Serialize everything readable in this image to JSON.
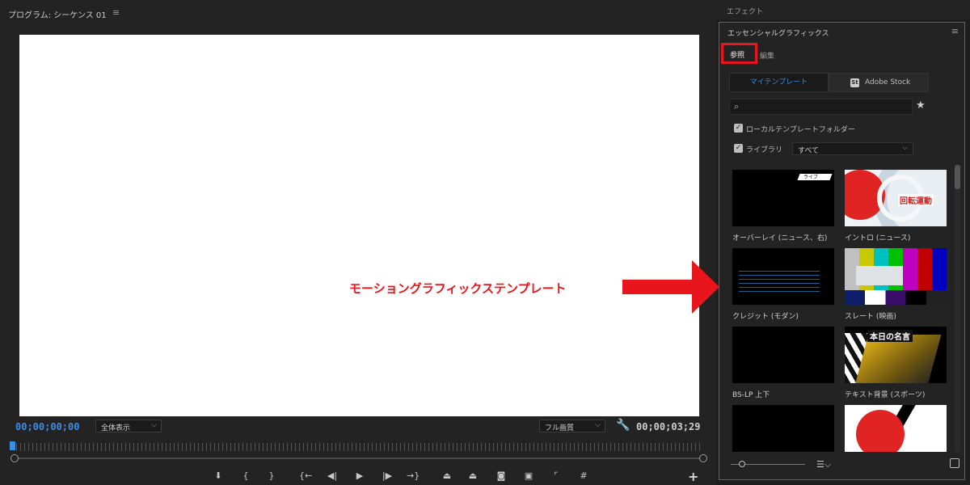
{
  "program": {
    "title": "プログラム: シーケンス 01",
    "menu_icon": "hamburger-icon",
    "current_timecode": "00;00;00;00",
    "duration_timecode": "00;00;03;29",
    "zoom_select": "全体表示",
    "quality_select": "フル画質",
    "controls": [
      {
        "name": "add-marker-button",
        "glyph": "⬇"
      },
      {
        "name": "mark-in-button",
        "glyph": "{"
      },
      {
        "name": "mark-out-button",
        "glyph": "}"
      },
      {
        "name": "go-to-in-button",
        "glyph": "{←"
      },
      {
        "name": "step-back-button",
        "glyph": "◀|"
      },
      {
        "name": "play-button",
        "glyph": "▶"
      },
      {
        "name": "step-forward-button",
        "glyph": "|▶"
      },
      {
        "name": "go-to-out-button",
        "glyph": "→}"
      },
      {
        "name": "lift-button",
        "glyph": "⏏"
      },
      {
        "name": "extract-button",
        "glyph": "⏏"
      },
      {
        "name": "export-frame-button",
        "glyph": "◙"
      },
      {
        "name": "comparison-view-button",
        "glyph": "▣"
      },
      {
        "name": "safe-margins-button",
        "glyph": "⌜"
      },
      {
        "name": "toggle-proxies-button",
        "glyph": "#"
      }
    ],
    "add_glyph": "+"
  },
  "effects_tab": "エフェクト",
  "essential_graphics": {
    "title": "エッセンシャルグラフィックス",
    "tabs": {
      "browse": "参照",
      "edit": "編集"
    },
    "sources": {
      "my_templates": "マイテンプレート",
      "adobe_stock": "Adobe Stock",
      "stock_badge": "St"
    },
    "search": {
      "placeholder": ""
    },
    "local_templates_label": "ローカルテンプレートフォルダー",
    "library_label": "ライブラリ",
    "library_value": "すべて",
    "templates": [
      {
        "caption": "オーバーレイ (ニュース、右)",
        "thumb_text": "ライブ"
      },
      {
        "caption": "イントロ (ニュース)",
        "thumb_text": "回転運動"
      },
      {
        "caption": "クレジット (モダン)"
      },
      {
        "caption": "スレート (映画)"
      },
      {
        "caption": "BS-LP 上下"
      },
      {
        "caption": "テキスト背景 (スポーツ)",
        "thumb_text": "本日の名言"
      }
    ]
  },
  "annotation": {
    "label": "モーショングラフィックステンプレート",
    "color": "#e8161c"
  },
  "colors": {
    "accent_blue": "#3c8ee8",
    "highlight_red": "#e8161c",
    "panel_bg": "#232323"
  }
}
